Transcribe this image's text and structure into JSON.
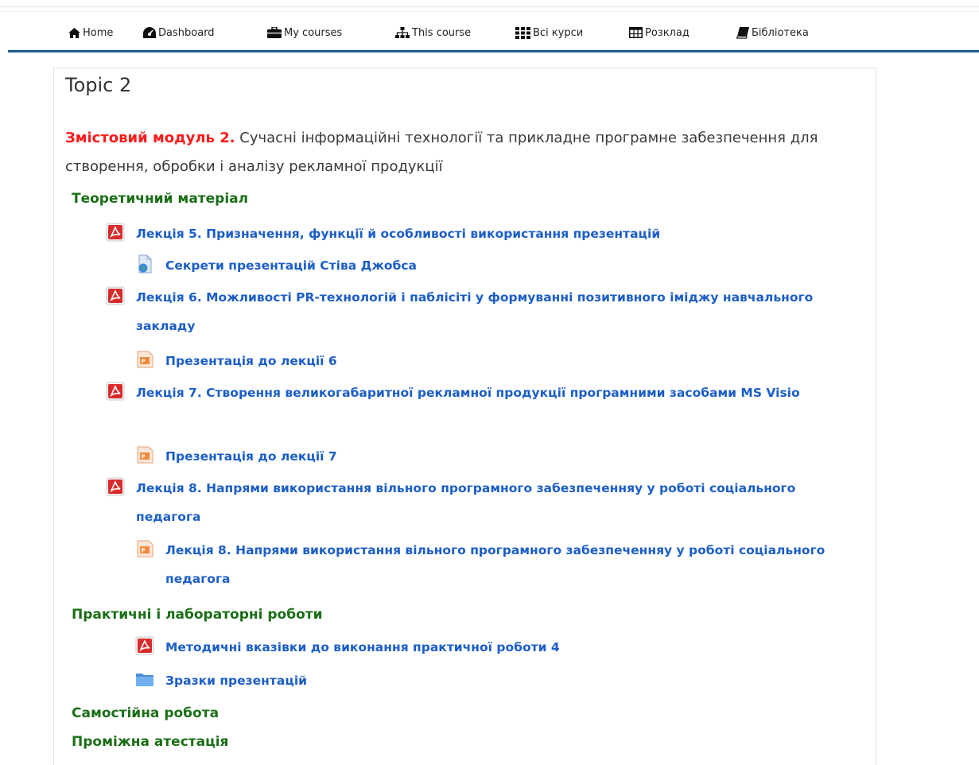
{
  "nav": {
    "items": [
      {
        "label": "Home",
        "icon": "home-icon"
      },
      {
        "label": "Dashboard",
        "icon": "dashboard-icon"
      },
      {
        "label": "My courses",
        "icon": "briefcase-icon"
      },
      {
        "label": "This course",
        "icon": "sitemap-icon"
      },
      {
        "label": "Всі курси",
        "icon": "grid-icon"
      },
      {
        "label": "Розклад",
        "icon": "table-icon"
      },
      {
        "label": "Бібліотека",
        "icon": "book-icon"
      }
    ]
  },
  "section": {
    "title": "Topic 2",
    "summary_red": "Змістовий модуль 2.",
    "summary_text": " Сучасні інформаційні технології та прикладне програмне забезпечення для створення, обробки і аналізу рекламної продукції"
  },
  "headings": {
    "theory": "Теоретичний матеріал",
    "practice": "Практичні і лабораторні роботи",
    "self": "Самостійна робота",
    "attestation": "Проміжна атестація"
  },
  "activities": [
    {
      "label": "Лекція 5. Призначення, функції й особливості використання презентацій",
      "icon": "pdf-icon"
    },
    {
      "label": "Секрети презентацій Стіва Джобса",
      "icon": "url-icon"
    },
    {
      "label": "Лекція 6. Можливості PR-технологій і паблісіті у формуванні позитивного іміджу навчального закладу",
      "icon": "pdf-icon"
    },
    {
      "label": "Презентація до лекції 6",
      "icon": "powerpoint-icon"
    },
    {
      "label": "Лекція 7. Створення великогабаритної рекламної продукції програмними засобами MS Visio",
      "icon": "pdf-icon"
    },
    {
      "label": "Презентація до лекції 7",
      "icon": "powerpoint-icon"
    },
    {
      "label": "Лекція 8. Напрями використання вільного програмного забезпеченняу у роботі соціального педагога",
      "icon": "pdf-icon"
    },
    {
      "label": "Лекція 8. Напрями використання вільного програмного забезпеченняу у роботі соціального педагога",
      "icon": "powerpoint-icon"
    },
    {
      "label": "Методичні вказівки до виконання практичної роботи 4",
      "icon": "pdf-icon"
    },
    {
      "label": "Зразки презентацій",
      "icon": "folder-icon"
    }
  ],
  "colors": {
    "link": "#1c5ec7",
    "heading": "#1a6e16",
    "accent_red": "#ff1a1a",
    "nav_border": "#1d5d8f"
  }
}
